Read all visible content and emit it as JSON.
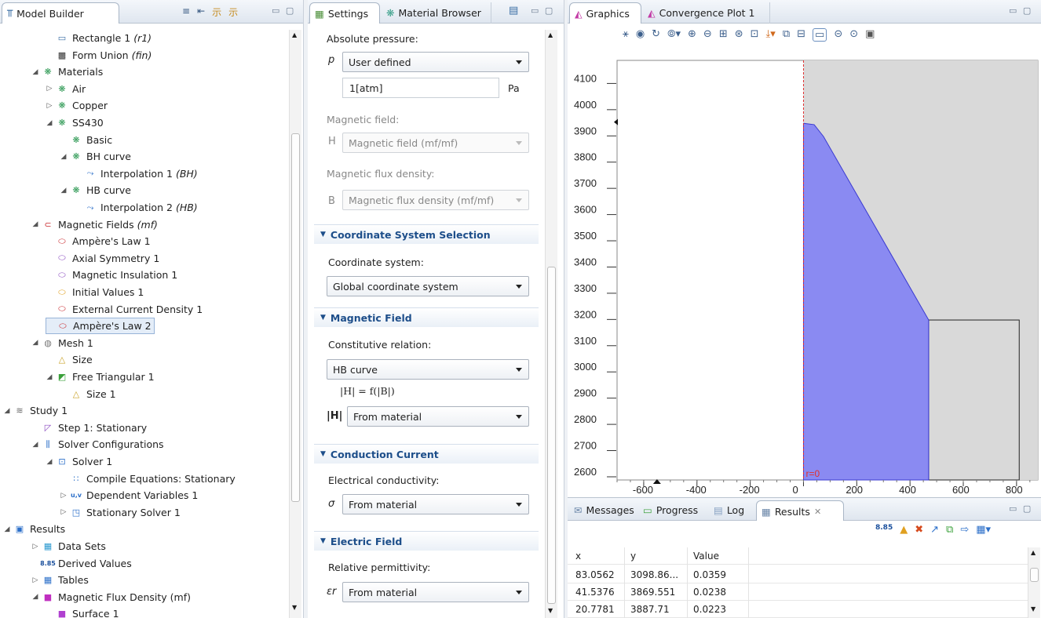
{
  "model_builder": {
    "title": "Model Builder",
    "items": [
      {
        "label": "Rectangle 1",
        "sub": "(r1)",
        "icon": "rectangle-icon",
        "level": 4,
        "exp": ""
      },
      {
        "label": "Form Union",
        "sub": "(fin)",
        "icon": "form-union-icon",
        "level": 4,
        "exp": ""
      },
      {
        "label": "Materials",
        "sub": "",
        "icon": "materials-icon",
        "level": 3,
        "exp": "open"
      },
      {
        "label": "Air",
        "sub": "",
        "icon": "material-icon",
        "level": 4,
        "exp": "closed"
      },
      {
        "label": "Copper",
        "sub": "",
        "icon": "material-icon",
        "level": 4,
        "exp": "closed"
      },
      {
        "label": "SS430",
        "sub": "",
        "icon": "material-icon",
        "level": 4,
        "exp": "open"
      },
      {
        "label": "Basic",
        "sub": "",
        "icon": "material-icon",
        "level": 5,
        "exp": ""
      },
      {
        "label": "BH curve",
        "sub": "",
        "icon": "material-icon",
        "level": 5,
        "exp": "open"
      },
      {
        "label": "Interpolation 1",
        "sub": "(BH)",
        "icon": "interpolation-icon",
        "level": 6,
        "exp": ""
      },
      {
        "label": "HB curve",
        "sub": "",
        "icon": "material-icon",
        "level": 5,
        "exp": "open"
      },
      {
        "label": "Interpolation 2",
        "sub": "(HB)",
        "icon": "interpolation-icon",
        "level": 6,
        "exp": ""
      },
      {
        "label": "Magnetic Fields",
        "sub": "(mf)",
        "icon": "magnetic-fields-icon",
        "level": 3,
        "exp": "open"
      },
      {
        "label": "Ampère's Law 1",
        "sub": "",
        "icon": "domain-icon",
        "level": 4,
        "exp": ""
      },
      {
        "label": "Axial Symmetry 1",
        "sub": "",
        "icon": "boundary-icon",
        "level": 4,
        "exp": ""
      },
      {
        "label": "Magnetic Insulation 1",
        "sub": "",
        "icon": "boundary-icon",
        "level": 4,
        "exp": ""
      },
      {
        "label": "Initial Values 1",
        "sub": "",
        "icon": "initial-values-icon",
        "level": 4,
        "exp": ""
      },
      {
        "label": "External Current Density 1",
        "sub": "",
        "icon": "domain-icon",
        "level": 4,
        "exp": ""
      },
      {
        "label": "Ampère's Law 2",
        "sub": "",
        "icon": "domain-icon",
        "level": 4,
        "exp": "",
        "selected": true
      },
      {
        "label": "Mesh 1",
        "sub": "",
        "icon": "mesh-icon",
        "level": 3,
        "exp": "open"
      },
      {
        "label": "Size",
        "sub": "",
        "icon": "size-icon",
        "level": 4,
        "exp": ""
      },
      {
        "label": "Free Triangular 1",
        "sub": "",
        "icon": "free-triangular-icon",
        "level": 4,
        "exp": "open"
      },
      {
        "label": "Size 1",
        "sub": "",
        "icon": "size-icon",
        "level": 5,
        "exp": ""
      },
      {
        "label": "Study 1",
        "sub": "",
        "icon": "study-icon",
        "level": 1,
        "exp": "open"
      },
      {
        "label": "Step 1: Stationary",
        "sub": "",
        "icon": "stationary-step-icon",
        "level": 3,
        "exp": ""
      },
      {
        "label": "Solver Configurations",
        "sub": "",
        "icon": "solver-configurations-icon",
        "level": 3,
        "exp": "open"
      },
      {
        "label": "Solver 1",
        "sub": "",
        "icon": "solver-icon",
        "level": 4,
        "exp": "open"
      },
      {
        "label": "Compile Equations: Stationary",
        "sub": "",
        "icon": "compile-equations-icon",
        "level": 5,
        "exp": ""
      },
      {
        "label": "Dependent Variables 1",
        "sub": "",
        "icon": "dependent-variables-icon",
        "level": 5,
        "exp": "closed"
      },
      {
        "label": "Stationary Solver 1",
        "sub": "",
        "icon": "stationary-solver-icon",
        "level": 5,
        "exp": "closed"
      },
      {
        "label": "Results",
        "sub": "",
        "icon": "results-icon",
        "level": 1,
        "exp": "open"
      },
      {
        "label": "Data Sets",
        "sub": "",
        "icon": "data-sets-icon",
        "level": 3,
        "exp": "closed"
      },
      {
        "label": "Derived Values",
        "sub": "",
        "icon": "derived-values-icon",
        "level": 3,
        "exp": ""
      },
      {
        "label": "Tables",
        "sub": "",
        "icon": "tables-icon",
        "level": 3,
        "exp": "closed"
      },
      {
        "label": "Magnetic Flux Density (mf)",
        "sub": "",
        "icon": "plot-group-icon",
        "level": 3,
        "exp": "open"
      },
      {
        "label": "Surface 1",
        "sub": "",
        "icon": "surface-icon",
        "level": 4,
        "exp": ""
      }
    ]
  },
  "settings": {
    "tab_settings": "Settings",
    "tab_material_browser": "Material Browser",
    "absolute_pressure_label": "Absolute pressure:",
    "pressure_symbol": "p",
    "pressure_option": "User defined",
    "pressure_value": "1[atm]",
    "pressure_unit": "Pa",
    "magnetic_field_label": "Magnetic field:",
    "magnetic_field_symbol": "H",
    "magnetic_field_option": "Magnetic field (mf/mf)",
    "flux_density_label": "Magnetic flux density:",
    "flux_density_symbol": "B",
    "flux_density_option": "Magnetic flux density (mf/mf)",
    "section_coordinate": "Coordinate System Selection",
    "coordinate_label": "Coordinate system:",
    "coordinate_option": "Global coordinate system",
    "section_magnetic_field": "Magnetic Field",
    "constitutive_label": "Constitutive relation:",
    "constitutive_option": "HB curve",
    "relation_formula": "|H| = f(|B|)",
    "h_symbol": "|H|",
    "h_option": "From material",
    "section_conduction": "Conduction Current",
    "conductivity_label": "Electrical conductivity:",
    "sigma_symbol": "σ",
    "sigma_option": "From material",
    "section_electric": "Electric Field",
    "permittivity_label": "Relative permittivity:",
    "eps_symbol": "εr",
    "eps_option": "From material"
  },
  "graphics": {
    "tab_graphics": "Graphics",
    "tab_convergence": "Convergence Plot 1",
    "y_ticks": [
      "4100",
      "4000",
      "3900",
      "3800",
      "3700",
      "3600",
      "3500",
      "3400",
      "3300",
      "3200",
      "3100",
      "3000",
      "2900",
      "2800",
      "2700",
      "2600"
    ],
    "x_ticks": [
      "-600",
      "-400",
      "-200",
      "0",
      "200",
      "400",
      "600",
      "800"
    ],
    "axis_label": "r=0",
    "fill_color": "#8a8af2",
    "domain_color": "#d9d9d9"
  },
  "results": {
    "tab_messages": "Messages",
    "tab_progress": "Progress",
    "tab_log": "Log",
    "tab_results": "Results",
    "columns": [
      "x",
      "y",
      "Value"
    ],
    "rows": [
      [
        "83.0562",
        "3098.86...",
        "0.0359"
      ],
      [
        "41.5376",
        "3869.551",
        "0.0238"
      ],
      [
        "20.7781",
        "3887.71",
        "0.0223"
      ]
    ]
  }
}
